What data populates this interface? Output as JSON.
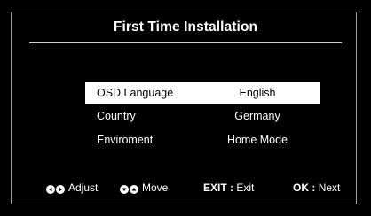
{
  "dialog": {
    "title": "First Time Installation"
  },
  "settings": [
    {
      "label": "OSD Language",
      "value": "English",
      "selected": true
    },
    {
      "label": "Country",
      "value": "Germany",
      "selected": false
    },
    {
      "label": "Enviroment",
      "value": "Home Mode",
      "selected": false
    }
  ],
  "footer": {
    "adjust_label": "Adjust",
    "move_label": "Move",
    "exit_key": "EXIT",
    "exit_sep": ":",
    "exit_label": "Exit",
    "ok_key": "OK",
    "ok_sep": ":",
    "ok_label": "Next"
  },
  "icons": {
    "adjust": [
      "left-arrow-icon",
      "right-arrow-icon"
    ],
    "move": [
      "down-arrow-icon",
      "up-arrow-icon"
    ]
  },
  "colors": {
    "background": "#000000",
    "text": "#ffffff",
    "selection_bg": "#ffffff",
    "selection_text": "#000000",
    "frame_border": "#9a9a9a"
  }
}
